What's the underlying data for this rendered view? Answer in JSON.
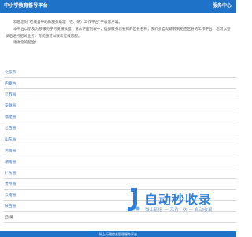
{
  "header": {
    "title": "中小学教育督导平台",
    "service_link": "服务中心"
  },
  "intro": {
    "paragraphs": [
      "欢迎您对“在线督导助教服务助理（在、研）工作平台”平板客户端。",
      "本平台以示及为移服务学习发报数措。请从下面列表中，选择服务您要到的区县名称，我们会自动跳转到相应区县的工作平台，您可以登录后进行相关业务，有问题可以联系在线客服。"
    ],
    "thanks": "谢谢您的配合！"
  },
  "regions": [
    "北京市",
    "内蒙古",
    "江苏省",
    "安徽省",
    "福建省",
    "江西省",
    "山东省",
    "河南省",
    "湖南省",
    "广东省",
    "贵州省",
    "云南省",
    "陕西省",
    "西 藏"
  ],
  "footer": {
    "text": "网上行政综合管理服务平台"
  },
  "watermark": {
    "text": "自动秒收录",
    "subtext": "做上链接 — 来访一次 — 自动收录"
  },
  "colors": {
    "brand": "#1e73c8",
    "link": "#3a72b8",
    "divider": "#d8d8d8"
  }
}
